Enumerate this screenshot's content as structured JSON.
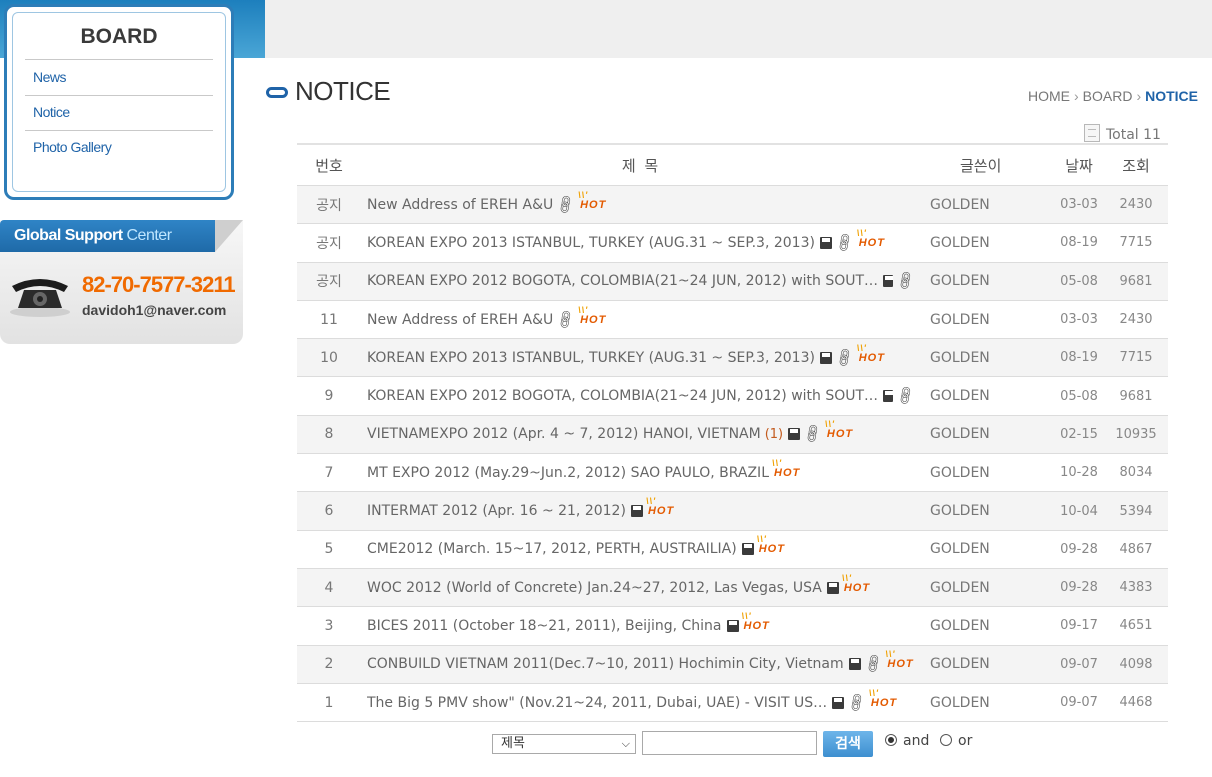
{
  "sidebar": {
    "board_title": "BOARD",
    "items": [
      {
        "label": "News"
      },
      {
        "label": "Notice"
      },
      {
        "label": "Photo Gallery"
      }
    ]
  },
  "support": {
    "title_main": "Global Support",
    "title_highlight": "Center",
    "phone": "82-70-7577-3211",
    "email": "davidoh1@naver.com"
  },
  "page": {
    "title": "NOTICE",
    "breadcrumb": [
      "HOME",
      "BOARD",
      "NOTICE"
    ],
    "total_label": "Total 11"
  },
  "table": {
    "headers": {
      "num": "번호",
      "title": "제    목",
      "writer": "글쓴이",
      "date": "날짜",
      "views": "조회"
    },
    "rows": [
      {
        "num": "공지",
        "title": "New Address of EREH A&U",
        "comment": "",
        "disk": false,
        "link": true,
        "hot": true,
        "writer": "GOLDEN",
        "date": "03-03",
        "views": "2430"
      },
      {
        "num": "공지",
        "title": "KOREAN EXPO 2013 ISTANBUL, TURKEY (AUG.31 ~ SEP.3, 2013)",
        "comment": "",
        "disk": true,
        "link": true,
        "hot": true,
        "writer": "GOLDEN",
        "date": "08-19",
        "views": "7715"
      },
      {
        "num": "공지",
        "title": "KOREAN EXPO 2012 BOGOTA, COLOMBIA(21~24 JUN, 2012) with SOUT…",
        "comment": "",
        "disk": true,
        "link": true,
        "hot": false,
        "writer": "GOLDEN",
        "date": "05-08",
        "views": "9681"
      },
      {
        "num": "11",
        "title": "New Address of EREH A&U",
        "comment": "",
        "disk": false,
        "link": true,
        "hot": true,
        "writer": "GOLDEN",
        "date": "03-03",
        "views": "2430"
      },
      {
        "num": "10",
        "title": "KOREAN EXPO 2013 ISTANBUL, TURKEY (AUG.31 ~ SEP.3, 2013)",
        "comment": "",
        "disk": true,
        "link": true,
        "hot": true,
        "writer": "GOLDEN",
        "date": "08-19",
        "views": "7715"
      },
      {
        "num": "9",
        "title": "KOREAN EXPO 2012 BOGOTA, COLOMBIA(21~24 JUN, 2012) with SOUT…",
        "comment": "",
        "disk": true,
        "link": true,
        "hot": false,
        "writer": "GOLDEN",
        "date": "05-08",
        "views": "9681"
      },
      {
        "num": "8",
        "title": "VIETNAMEXPO 2012 (Apr. 4 ~ 7, 2012) HANOI, VIETNAM",
        "comment": "(1)",
        "disk": true,
        "link": true,
        "hot": true,
        "writer": "GOLDEN",
        "date": "02-15",
        "views": "10935"
      },
      {
        "num": "7",
        "title": "MT EXPO 2012 (May.29~Jun.2, 2012) SAO PAULO, BRAZIL",
        "comment": "",
        "disk": false,
        "link": false,
        "hot": true,
        "writer": "GOLDEN",
        "date": "10-28",
        "views": "8034"
      },
      {
        "num": "6",
        "title": "INTERMAT 2012 (Apr. 16 ~ 21, 2012)",
        "comment": "",
        "disk": true,
        "link": false,
        "hot": true,
        "writer": "GOLDEN",
        "date": "10-04",
        "views": "5394"
      },
      {
        "num": "5",
        "title": "CME2012 (March. 15~17, 2012, PERTH, AUSTRAILIA)",
        "comment": "",
        "disk": true,
        "link": false,
        "hot": true,
        "writer": "GOLDEN",
        "date": "09-28",
        "views": "4867"
      },
      {
        "num": "4",
        "title": "WOC 2012 (World of Concrete) Jan.24~27, 2012, Las Vegas, USA",
        "comment": "",
        "disk": true,
        "link": false,
        "hot": true,
        "writer": "GOLDEN",
        "date": "09-28",
        "views": "4383"
      },
      {
        "num": "3",
        "title": "BICES 2011 (October 18~21, 2011), Beijing, China",
        "comment": "",
        "disk": true,
        "link": false,
        "hot": true,
        "writer": "GOLDEN",
        "date": "09-17",
        "views": "4651"
      },
      {
        "num": "2",
        "title": "CONBUILD VIETNAM 2011(Dec.7~10, 2011) Hochimin City, Vietnam",
        "comment": "",
        "disk": true,
        "link": true,
        "hot": true,
        "writer": "GOLDEN",
        "date": "09-07",
        "views": "4098"
      },
      {
        "num": "1",
        "title": "The Big 5 PMV show\" (Nov.21~24, 2011, Dubai, UAE) - VISIT US…",
        "comment": "",
        "disk": true,
        "link": true,
        "hot": true,
        "writer": "GOLDEN",
        "date": "09-07",
        "views": "4468"
      }
    ]
  },
  "icons": {
    "disk": "floppy-disk-icon",
    "link": "link-icon",
    "hot": "hot-badge-icon",
    "hot_text": "HOT"
  },
  "search": {
    "field_selected": "제목",
    "input_value": "",
    "button_label": "검색",
    "option_and": "and",
    "option_or": "or",
    "selected_option": "and"
  },
  "colors": {
    "accent": "#1f63a8",
    "hot": "#e35a00",
    "phone": "#f06a00"
  }
}
